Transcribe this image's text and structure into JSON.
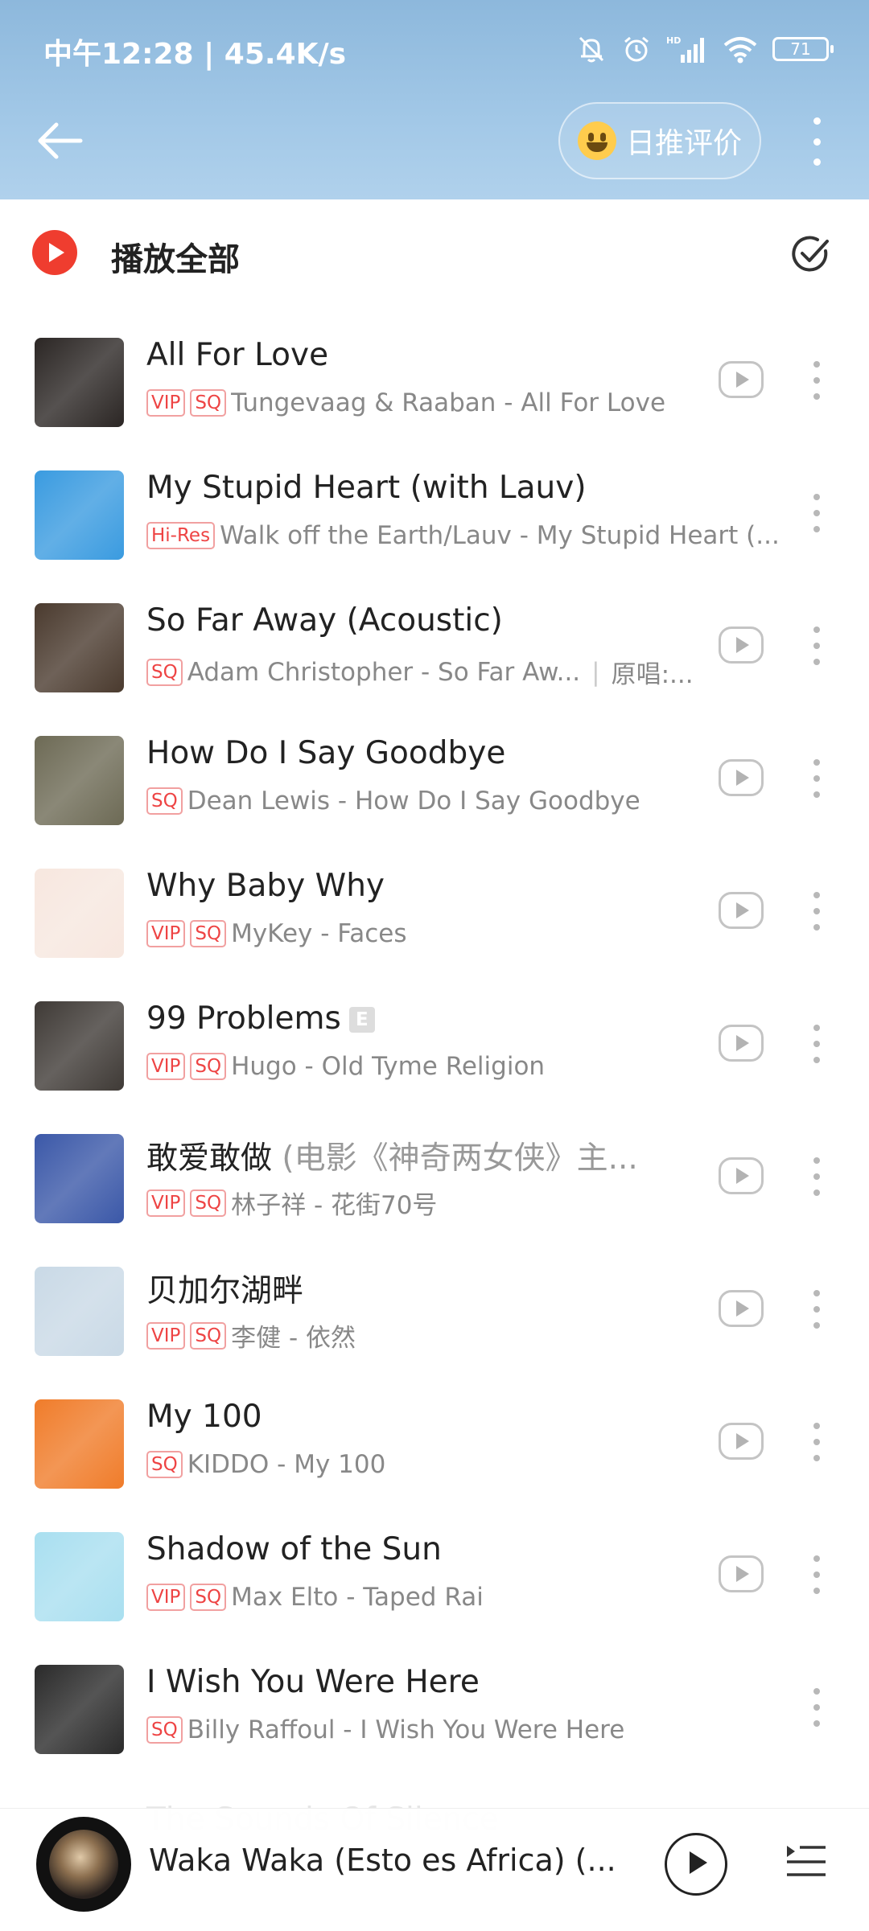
{
  "status_bar": {
    "time": "中午12:28 | 45.4K/s",
    "battery": "71"
  },
  "header": {
    "rating_button": "日推评价"
  },
  "play_all": {
    "label": "播放全部"
  },
  "songs": [
    {
      "title": "All For Love",
      "subtitle": "",
      "explicit": false,
      "badges": [
        "VIP",
        "SQ"
      ],
      "meta": "Tungevaag & Raaban - All For Love",
      "original": "",
      "mv": true
    },
    {
      "title": "My Stupid Heart (with Lauv)",
      "subtitle": "",
      "explicit": false,
      "badges": [
        "Hi-Res"
      ],
      "meta": "Walk off the Earth/Lauv - My Stupid Heart (...",
      "original": "",
      "mv": false
    },
    {
      "title": "So Far Away (Acoustic)",
      "subtitle": "",
      "explicit": false,
      "badges": [
        "SQ"
      ],
      "meta": "Adam Christopher - So Far Aw...",
      "original": "原唱:...",
      "mv": true
    },
    {
      "title": "How Do I Say Goodbye",
      "subtitle": "",
      "explicit": false,
      "badges": [
        "SQ"
      ],
      "meta": "Dean Lewis - How Do I Say Goodbye",
      "original": "",
      "mv": true
    },
    {
      "title": "Why Baby Why",
      "subtitle": "",
      "explicit": false,
      "badges": [
        "VIP",
        "SQ"
      ],
      "meta": "MyKey - Faces",
      "original": "",
      "mv": true
    },
    {
      "title": "99 Problems",
      "subtitle": "",
      "explicit": true,
      "badges": [
        "VIP",
        "SQ"
      ],
      "meta": "Hugo - Old Tyme Religion",
      "original": "",
      "mv": true
    },
    {
      "title": "敢爱敢做",
      "subtitle": " (电影《神奇两女侠》主...",
      "explicit": false,
      "badges": [
        "VIP",
        "SQ"
      ],
      "meta": "林子祥 - 花街70号",
      "original": "",
      "mv": true
    },
    {
      "title": "贝加尔湖畔",
      "subtitle": "",
      "explicit": false,
      "badges": [
        "VIP",
        "SQ"
      ],
      "meta": "李健 - 依然",
      "original": "",
      "mv": true
    },
    {
      "title": "My 100",
      "subtitle": "",
      "explicit": false,
      "badges": [
        "SQ"
      ],
      "meta": "KIDDO - My 100",
      "original": "",
      "mv": true
    },
    {
      "title": "Shadow of the Sun",
      "subtitle": "",
      "explicit": false,
      "badges": [
        "VIP",
        "SQ"
      ],
      "meta": "Max Elto - Taped Rai",
      "original": "",
      "mv": true
    },
    {
      "title": "I Wish You Were Here",
      "subtitle": "",
      "explicit": false,
      "badges": [
        "SQ"
      ],
      "meta": "Billy Raffoul - I Wish You Were Here",
      "original": "",
      "mv": false
    }
  ],
  "explicit_label": "E",
  "partial_next_song": "The Sounds Of Silence",
  "player": {
    "now_playing": "Waka Waka (Esto es Africa) (..."
  },
  "cover_colors": [
    "#2b2624",
    "#3a9be0",
    "#4a3a2e",
    "#6d6a55",
    "#f7e7df",
    "#3f3a36",
    "#3b58a8",
    "#c9d9e6",
    "#f07c2a",
    "#a9dff0",
    "#2a2a2a"
  ],
  "icons": [
    "back-arrow-icon",
    "smile-emoji-icon",
    "more-vertical-icon",
    "play-circle-icon",
    "check-circle-icon",
    "mv-play-icon",
    "playlist-icon"
  ]
}
